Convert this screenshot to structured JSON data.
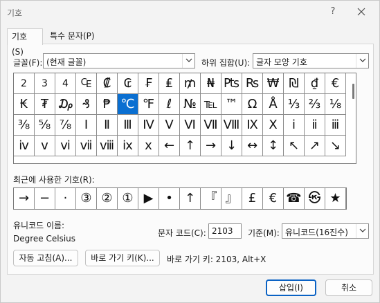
{
  "window": {
    "title": "기호",
    "help_label": "?"
  },
  "tabs": [
    {
      "label": "기호(S)",
      "active": true
    },
    {
      "label": "특수 문자(P)",
      "active": false
    }
  ],
  "font": {
    "label": "글꼴(F):",
    "value": "(현재 글꼴)"
  },
  "subset": {
    "label": "하위 집합(U):",
    "value": "글자 모양 기호"
  },
  "symbols": [
    [
      "2",
      "3",
      "4",
      "₠",
      "₡",
      "₢",
      "₣",
      "₤",
      "₥",
      "₦",
      "₧",
      "₨",
      "₩",
      "₪",
      "₫",
      "€"
    ],
    [
      "₭",
      "₮",
      "₯",
      "₰",
      "₱",
      "℃",
      "℉",
      "ℓ",
      "№",
      "℡",
      "™",
      "Ω",
      "Å",
      "⅓",
      "⅔",
      "⅛"
    ],
    [
      "⅜",
      "⅝",
      "⅞",
      "Ⅰ",
      "Ⅱ",
      "Ⅲ",
      "Ⅳ",
      "Ⅴ",
      "Ⅵ",
      "Ⅶ",
      "Ⅷ",
      "Ⅸ",
      "Ⅹ",
      "ⅰ",
      "ⅱ",
      "ⅲ"
    ],
    [
      "ⅳ",
      "ⅴ",
      "ⅵ",
      "ⅶ",
      "ⅷ",
      "ⅸ",
      "ⅹ",
      "←",
      "↑",
      "→",
      "↓",
      "↔",
      "↕",
      "↖",
      "↗",
      "↘"
    ]
  ],
  "selected_symbol": "℃",
  "recent": {
    "label": "최근에 사용한 기호(R):",
    "items": [
      "→",
      "−",
      "·",
      "③",
      "②",
      "①",
      "▶",
      "•",
      "↑",
      "『",
      "』",
      "£",
      "€",
      "☎",
      "㉿",
      "★"
    ]
  },
  "unicode_name": {
    "label": "유니코드 이름:",
    "value": "Degree Celsius"
  },
  "char_code": {
    "label": "문자 코드(C):",
    "value": "2103"
  },
  "from": {
    "label": "기준(M):",
    "value": "유니코드(16진수)"
  },
  "buttons": {
    "autocorrect": "자동 고침(A)...",
    "shortcut_key": "바로 가기 키(K)...",
    "insert": "삽입(I)",
    "cancel": "취소"
  },
  "shortcut_text": "바로 가기 키: 2103, Alt+X"
}
